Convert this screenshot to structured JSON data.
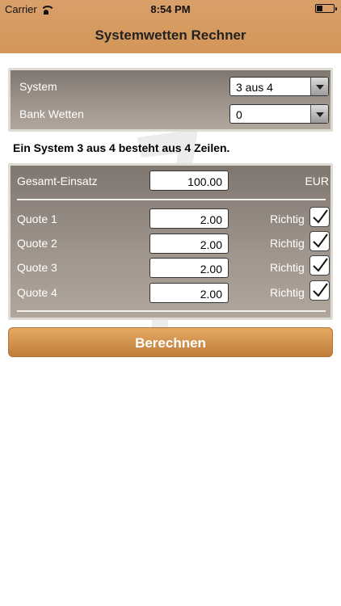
{
  "status_bar": {
    "carrier": "Carrier",
    "time": "8:54 PM"
  },
  "nav": {
    "title": "Systemwetten Rechner"
  },
  "system_panel": {
    "system_label": "System",
    "system_value": "3 aus 4",
    "bank_label": "Bank Wetten",
    "bank_value": "0"
  },
  "info_text": "Ein System 3 aus 4 besteht aus 4 Zeilen.",
  "stake": {
    "label": "Gesamt-Einsatz",
    "value": "100.00",
    "currency": "EUR"
  },
  "quotes": [
    {
      "label": "Quote 1",
      "value": "2.00",
      "status": "Richtig",
      "checked": true
    },
    {
      "label": "Quote 2",
      "value": "2.00",
      "status": "Richtig",
      "checked": true
    },
    {
      "label": "Quote 3",
      "value": "2.00",
      "status": "Richtig",
      "checked": true
    },
    {
      "label": "Quote 4",
      "value": "2.00",
      "status": "Richtig",
      "checked": true
    }
  ],
  "calculate_button": "Berechnen",
  "colors": {
    "nav": "#d39658",
    "panel": "#8f857c",
    "button": "#d4914d"
  }
}
